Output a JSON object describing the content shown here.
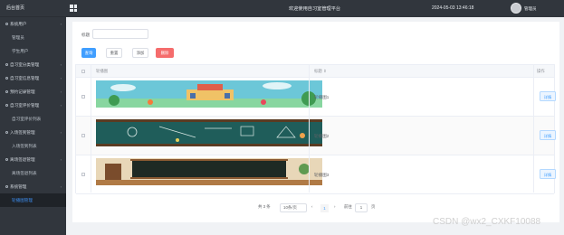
{
  "app": {
    "brand": "后台首页",
    "header_title": "欢迎使用自习室管理平台",
    "datetime": "2024-05-03 13:46:18",
    "user": "管理员"
  },
  "sidebar": {
    "items": [
      {
        "label": "系统用户",
        "level": 0
      },
      {
        "label": "管理员",
        "level": 1
      },
      {
        "label": "学生用户",
        "level": 1
      },
      {
        "label": "自习室分类管理",
        "level": 0
      },
      {
        "label": "自习室信息管理",
        "level": 0
      },
      {
        "label": "预约记录管理",
        "level": 0
      },
      {
        "label": "自习室评价管理",
        "level": 0
      },
      {
        "label": "自习室评价列表",
        "level": 1
      },
      {
        "label": "入场签到管理",
        "level": 0
      },
      {
        "label": "入场签到列表",
        "level": 1
      },
      {
        "label": "离场签退管理",
        "level": 0
      },
      {
        "label": "离场签退列表",
        "level": 1
      },
      {
        "label": "系统管理",
        "level": 0
      },
      {
        "label": "轮播图管理",
        "level": 1,
        "active": true
      }
    ]
  },
  "search": {
    "label": "标题",
    "value": ""
  },
  "toolbar": {
    "search": "查询",
    "reset": "重置",
    "add": "添加",
    "delete": "删除"
  },
  "table": {
    "headers": {
      "image": "轮播图",
      "title": "标题 ⇕",
      "ops": "操作"
    },
    "rows": [
      {
        "title": "轮播图1",
        "op": "详情"
      },
      {
        "title": "轮播图2",
        "op": "详情"
      },
      {
        "title": "轮播图3",
        "op": "详情"
      }
    ]
  },
  "pager": {
    "total": "共 3 条",
    "page_size": "10条/页",
    "prev": "‹",
    "current": "1",
    "next": "›",
    "goto_prefix": "前往",
    "goto_value": "1",
    "goto_suffix": "页"
  },
  "watermark": "CSDN @wx2_CXKF10088",
  "colors": {
    "sidebar_bg": "#31363d",
    "primary": "#409eff",
    "danger": "#f56c6c"
  }
}
